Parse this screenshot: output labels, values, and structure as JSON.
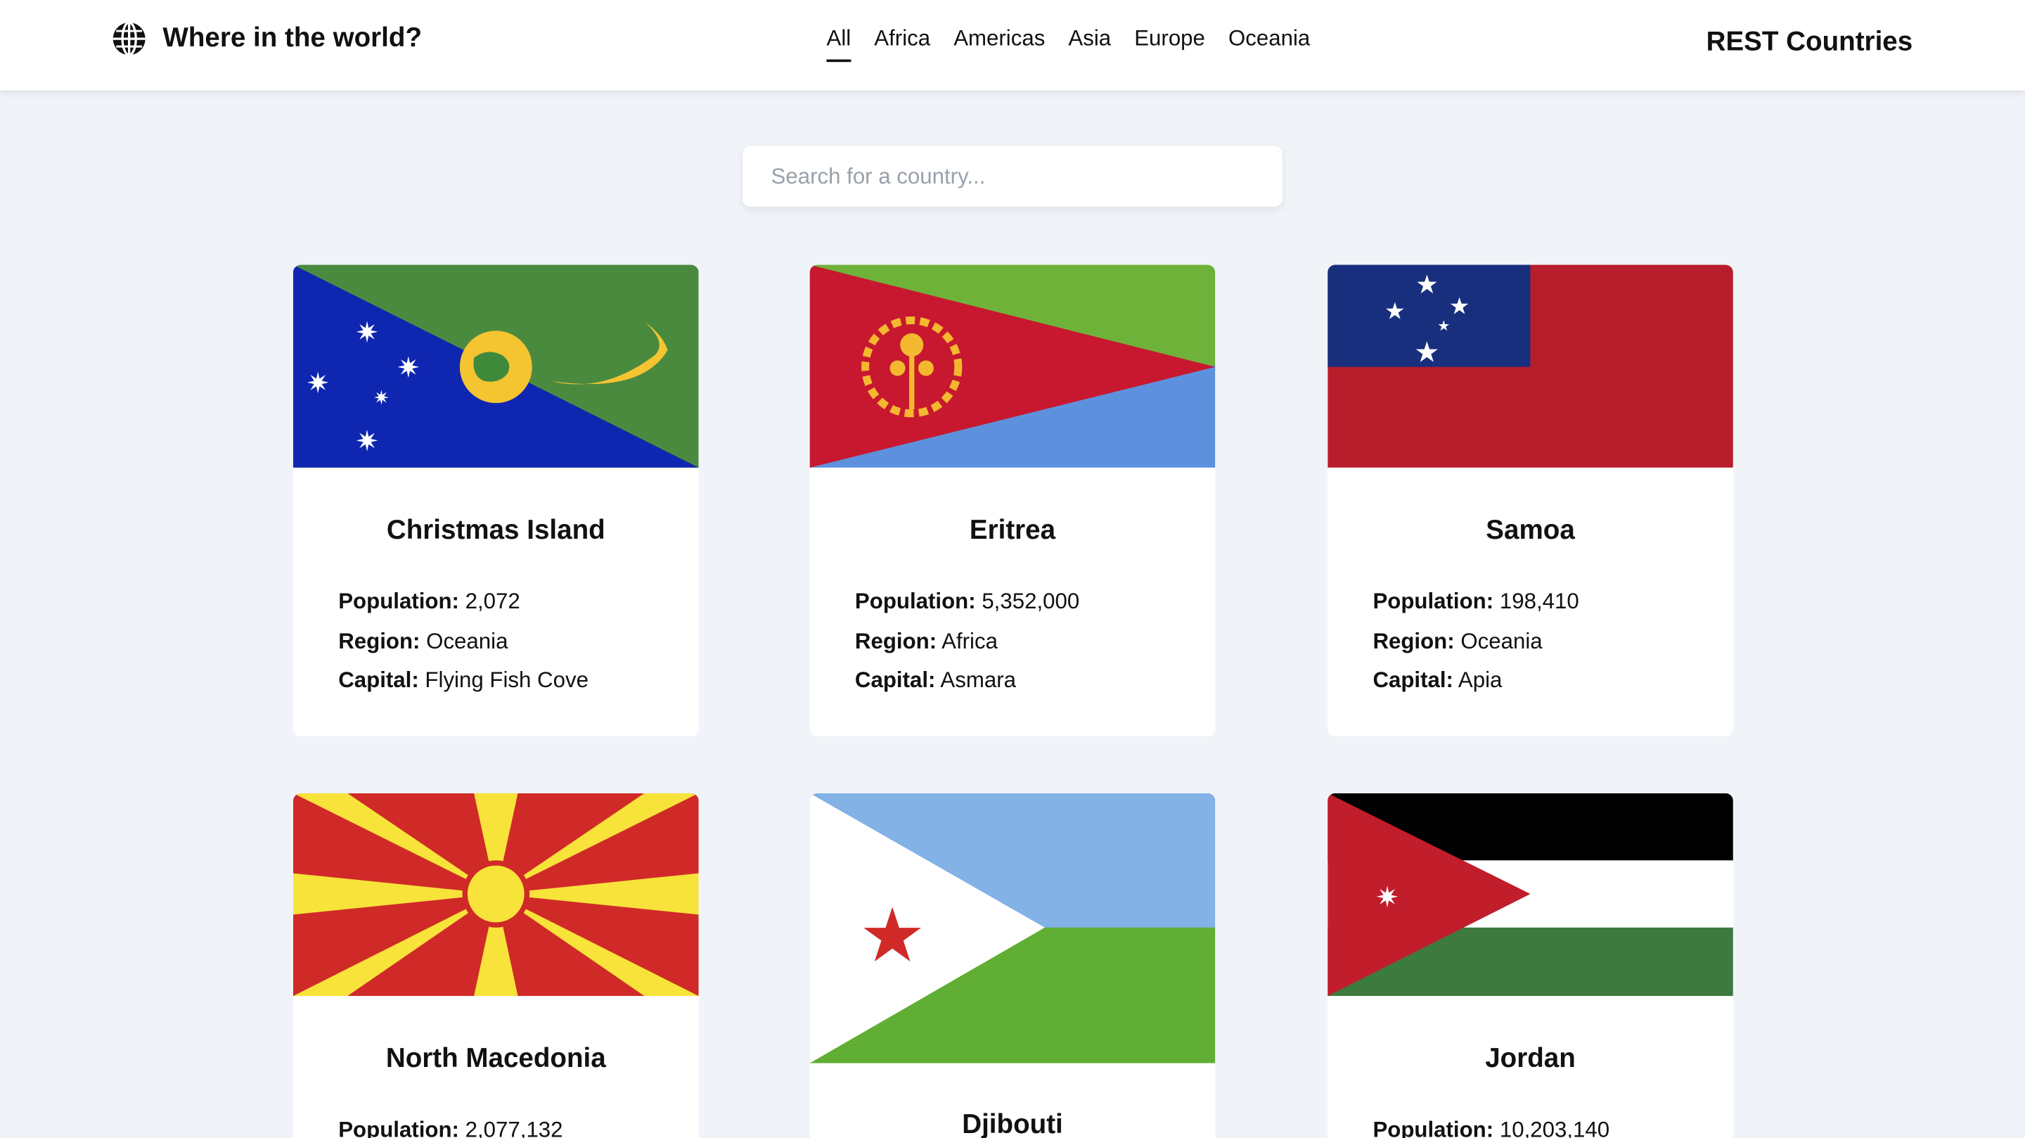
{
  "header": {
    "brand_title": "Where in the world?",
    "right_title": "REST Countries",
    "nav": [
      "All",
      "Africa",
      "Americas",
      "Asia",
      "Europe",
      "Oceania"
    ],
    "active_nav": "All"
  },
  "search": {
    "placeholder": "Search for a country..."
  },
  "labels": {
    "population": "Population:",
    "region": "Region:",
    "capital": "Capital:"
  },
  "countries": [
    {
      "name": "Christmas Island",
      "population": "2,072",
      "region": "Oceania",
      "capital": "Flying Fish Cove",
      "flag_icon": "christmas-island-flag"
    },
    {
      "name": "Eritrea",
      "population": "5,352,000",
      "region": "Africa",
      "capital": "Asmara",
      "flag_icon": "eritrea-flag"
    },
    {
      "name": "Samoa",
      "population": "198,410",
      "region": "Oceania",
      "capital": "Apia",
      "flag_icon": "samoa-flag"
    },
    {
      "name": "North Macedonia",
      "population": "2,077,132",
      "flag_icon": "north-macedonia-flag"
    },
    {
      "name": "Djibouti",
      "flag_icon": "djibouti-flag"
    },
    {
      "name": "Jordan",
      "population": "10,203,140",
      "flag_icon": "jordan-flag"
    }
  ]
}
